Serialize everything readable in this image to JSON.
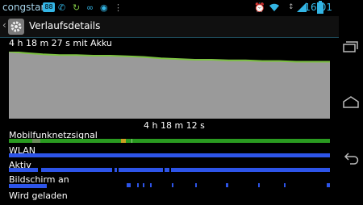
{
  "statusbar": {
    "carrier": "congstar",
    "badge": "88",
    "time": "16:01"
  },
  "actionbar": {
    "title": "Verlaufsdetails"
  },
  "battery": {
    "duration_label": "4 h 18 m 27 s mit Akku",
    "axis_time": "4 h 18 m 12 s",
    "series": [
      100,
      98,
      96,
      95,
      95,
      94,
      94,
      93,
      92,
      90,
      89,
      88,
      88,
      87,
      87,
      86,
      86,
      85,
      85,
      85
    ],
    "line_color": "#7dc242",
    "fill_color": "#9a9a9a"
  },
  "tracks": [
    {
      "label": "Mobilfunknetzsignal"
    },
    {
      "label": "WLAN"
    },
    {
      "label": "Aktiv"
    },
    {
      "label": "Bildschirm an"
    },
    {
      "label": "Wird geladen"
    }
  ],
  "colors": {
    "accent": "#33b5e5",
    "track_blue": "#2d54e8",
    "signal_green": "#2a9a20"
  }
}
